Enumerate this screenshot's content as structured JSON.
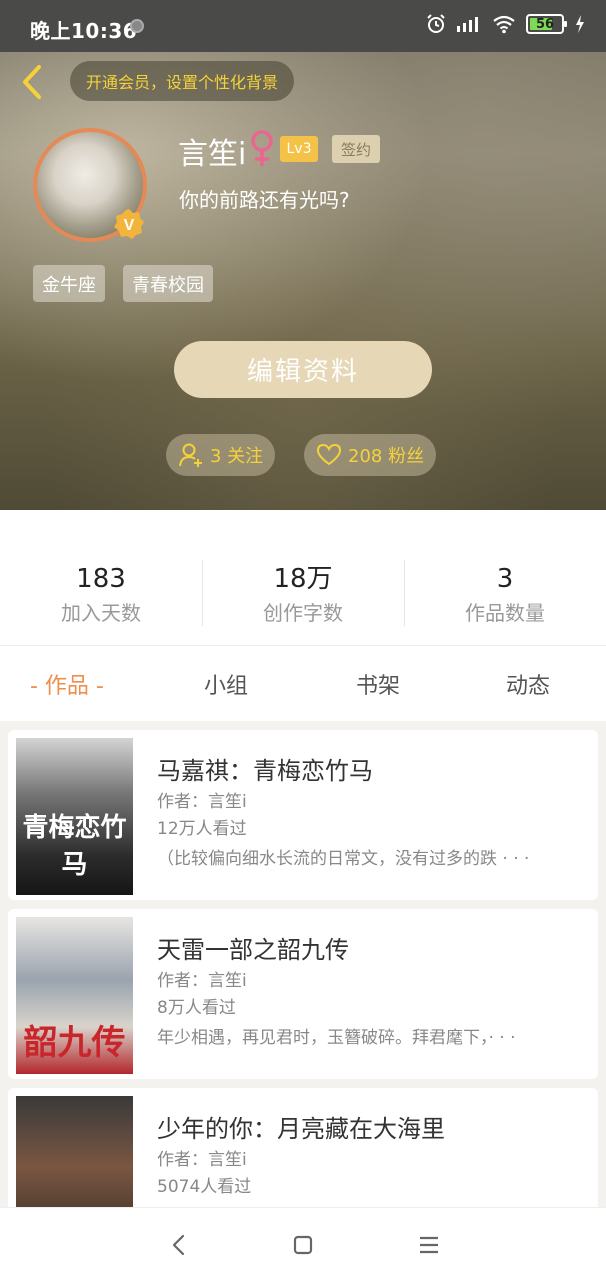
{
  "status_bar": {
    "time": "晚上10:36",
    "battery": "56"
  },
  "header": {
    "vip_prompt": "开通会员，设置个性化背景"
  },
  "profile": {
    "nickname": "言笙i",
    "level": "Lv3",
    "sign_badge": "签约",
    "bio": "你的前路还有光吗?",
    "tags": [
      "金牛座",
      "青春校园"
    ],
    "edit_button": "编辑资料",
    "following": "3 关注",
    "followers": "208 粉丝"
  },
  "stats": [
    {
      "value": "183",
      "label": "加入天数"
    },
    {
      "value": "18万",
      "label": "创作字数"
    },
    {
      "value": "3",
      "label": "作品数量"
    }
  ],
  "tabs": [
    "- 作品 -",
    "小组",
    "书架",
    "动态"
  ],
  "works": [
    {
      "title": "马嘉祺：青梅恋竹马",
      "author": "作者：言笙i",
      "views": "12万人看过",
      "desc": "（比较偏向细水长流的日常文，没有过多的跌 · · ·",
      "cover_text": "青梅恋竹马"
    },
    {
      "title": "天雷一部之韶九传",
      "author": "作者：言笙i",
      "views": "8万人看过",
      "desc": "年少相遇，再见君时，玉簪破碎。拜君麾下，· · ·",
      "cover_text": "韶九传"
    },
    {
      "title": "少年的你：月亮藏在大海里",
      "author": "作者：言笙i",
      "views": "5074人看过",
      "desc": "",
      "cover_text": ""
    }
  ],
  "colors": {
    "accent": "#ef8e4f",
    "vip_yellow": "#f5d23a",
    "level_badge": "#f4c247"
  }
}
